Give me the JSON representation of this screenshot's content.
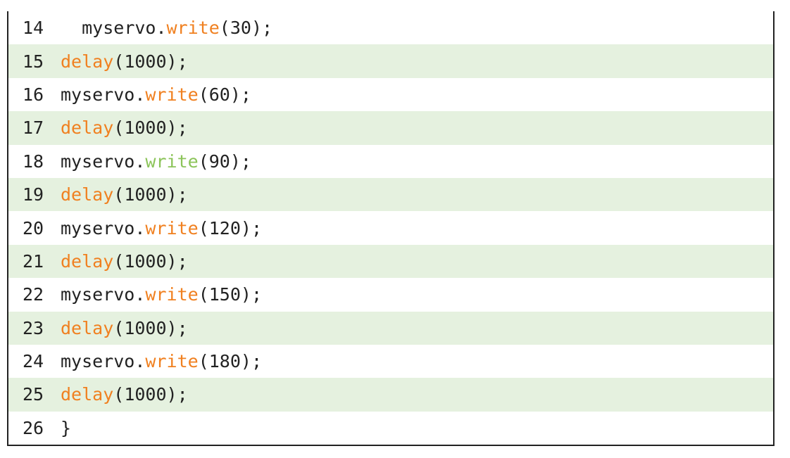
{
  "colors": {
    "keyword": "#f08020",
    "highlight": "#8cc45a",
    "stripe": "#e5f1df"
  },
  "lines": [
    {
      "n": "14",
      "indent": "  ",
      "obj": "myservo.",
      "fn": "write",
      "args": "(30);",
      "hl": false
    },
    {
      "n": "15",
      "indent": "",
      "obj": "",
      "fn": "delay",
      "args": "(1000);",
      "hl": false
    },
    {
      "n": "16",
      "indent": "",
      "obj": "myservo.",
      "fn": "write",
      "args": "(60);",
      "hl": false
    },
    {
      "n": "17",
      "indent": "",
      "obj": "",
      "fn": "delay",
      "args": "(1000);",
      "hl": false
    },
    {
      "n": "18",
      "indent": "",
      "obj": "myservo.",
      "fn": "write",
      "args": "(90);",
      "hl": true
    },
    {
      "n": "19",
      "indent": "",
      "obj": "",
      "fn": "delay",
      "args": "(1000);",
      "hl": false
    },
    {
      "n": "20",
      "indent": "",
      "obj": "myservo.",
      "fn": "write",
      "args": "(120);",
      "hl": false
    },
    {
      "n": "21",
      "indent": "",
      "obj": "",
      "fn": "delay",
      "args": "(1000);",
      "hl": false
    },
    {
      "n": "22",
      "indent": "",
      "obj": "myservo.",
      "fn": "write",
      "args": "(150);",
      "hl": false
    },
    {
      "n": "23",
      "indent": "",
      "obj": "",
      "fn": "delay",
      "args": "(1000);",
      "hl": false
    },
    {
      "n": "24",
      "indent": "",
      "obj": "myservo.",
      "fn": "write",
      "args": "(180);",
      "hl": false
    },
    {
      "n": "25",
      "indent": "",
      "obj": "",
      "fn": "delay",
      "args": "(1000);",
      "hl": false
    },
    {
      "n": "26",
      "indent": "",
      "obj": "}",
      "fn": "",
      "args": "",
      "hl": false
    }
  ]
}
